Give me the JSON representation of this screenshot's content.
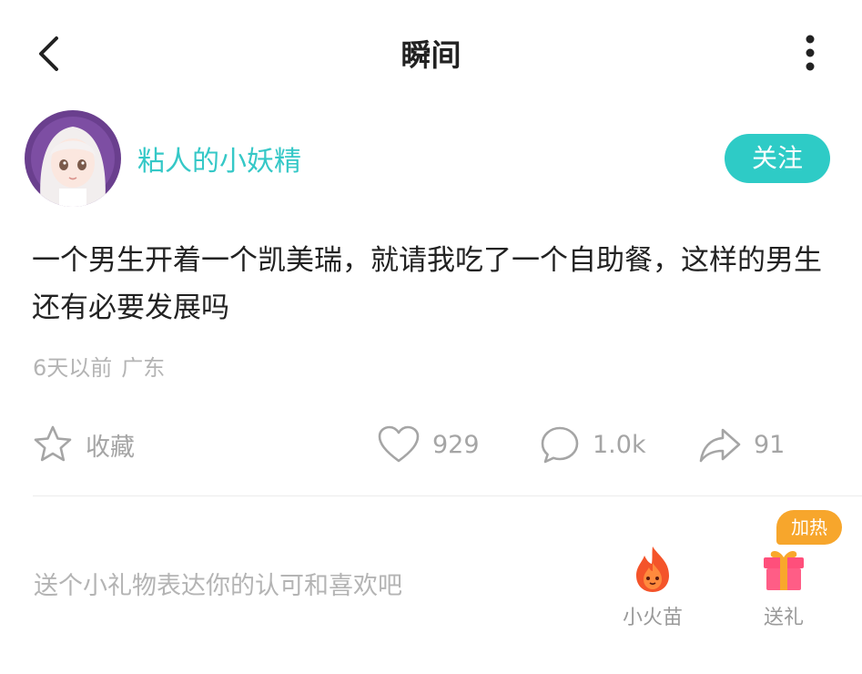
{
  "header": {
    "title": "瞬间",
    "back_icon": "chevron-left-icon",
    "more_icon": "more-vertical-icon"
  },
  "author": {
    "name": "粘人的小妖精",
    "follow_label": "关注"
  },
  "post": {
    "text": "一个男生开着一个凯美瑞，就请我吃了一个自助餐，这样的男生还有必要发展吗",
    "time": "6天以前",
    "location": "广东"
  },
  "actions": {
    "favorite_label": "收藏",
    "likes": "929",
    "comments": "1.0k",
    "shares": "91"
  },
  "gift": {
    "prompt": "送个小礼物表达你的认可和喜欢吧",
    "flame_label": "小火苗",
    "present_label": "送礼",
    "hot_badge": "加热"
  },
  "colors": {
    "accent": "#2ecbc6",
    "username": "#35c8c7",
    "badge": "#f7a62c",
    "muted": "#b4b4b4"
  }
}
